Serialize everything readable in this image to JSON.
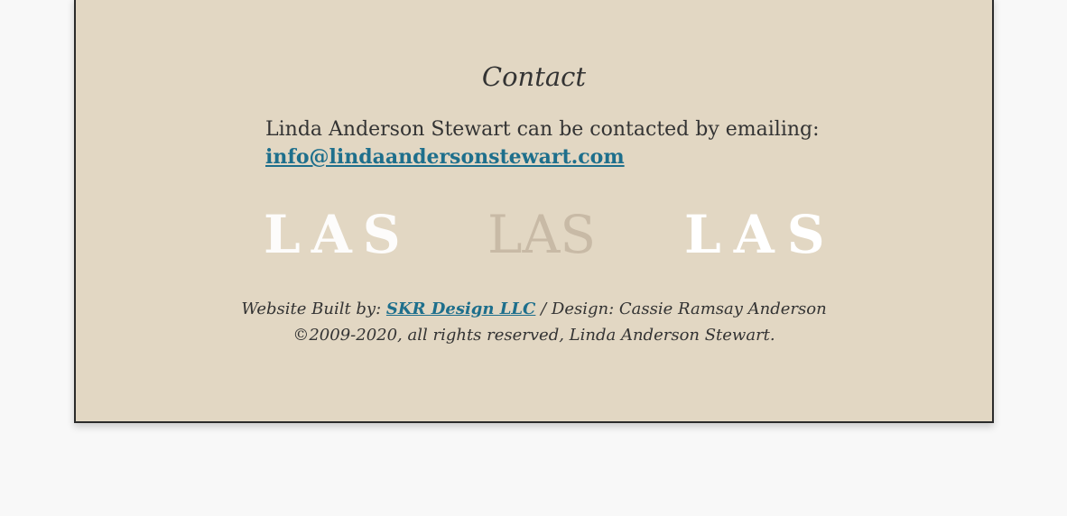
{
  "contact": {
    "title": "Contact",
    "intro": "Linda Anderson Stewart can be contacted by emailing:",
    "email": "info@lindaandersonstewart.com"
  },
  "logos": [
    "LAS",
    "LAS",
    "LAS"
  ],
  "credits": {
    "built_by_prefix": "Website Built by:",
    "builder_link": "SKR Design LLC",
    "design_credit": " / Design: Cassie Ramsay Anderson",
    "copyright": "©2009-2020, all rights reserved, Linda Anderson Stewart."
  },
  "colors": {
    "panel_background": "#e2d7c3",
    "link": "#1e6f8c",
    "page_background": "#f8f8f8"
  }
}
